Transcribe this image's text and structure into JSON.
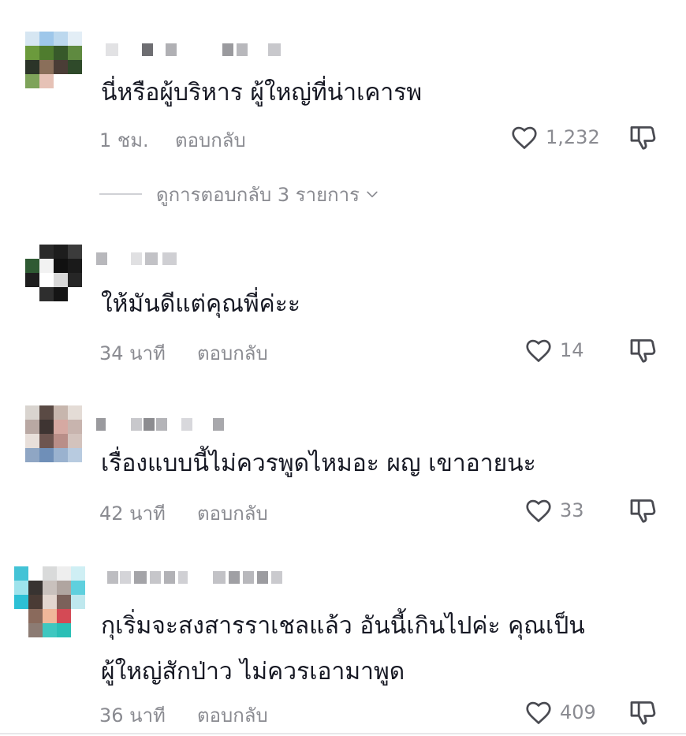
{
  "comments": [
    {
      "text_lines": [
        "นี่หรือผู้บริหาร ผู้ใหญ่ที่น่าเคารพ"
      ],
      "time": "1 ชม.",
      "reply_label": "ตอบกลับ",
      "likes": "1,232",
      "view_replies": "ดูการตอบกลับ 3 รายการ"
    },
    {
      "text_lines": [
        "ให้มันดีแต่คุณพี่ค่ะะ"
      ],
      "time": "34 นาที",
      "reply_label": "ตอบกลับ",
      "likes": "14"
    },
    {
      "text_lines": [
        "เรื่องแบบนี้ไม่ควรพูดไหมอะ ผญ เขาอายนะ"
      ],
      "time": "42 นาที",
      "reply_label": "ตอบกลับ",
      "likes": "33"
    },
    {
      "text_lines": [
        "กุเริ่มจะสงสารราเชลแล้ว อันนี้เกินไปค่ะ คุณเป็น",
        "ผู้ใหญ่สักป่าว ไม่ควรเอามาพูด"
      ],
      "time": "36 นาที",
      "reply_label": "ตอบกลับ",
      "likes": "409"
    }
  ],
  "icons": {
    "like": "heart-outline-icon",
    "dislike": "thumbs-down-outline-icon",
    "expand": "chevron-down-icon"
  },
  "colors": {
    "text": "#161823",
    "secondary": "#8a8b91",
    "icon": "#4a4b52"
  }
}
